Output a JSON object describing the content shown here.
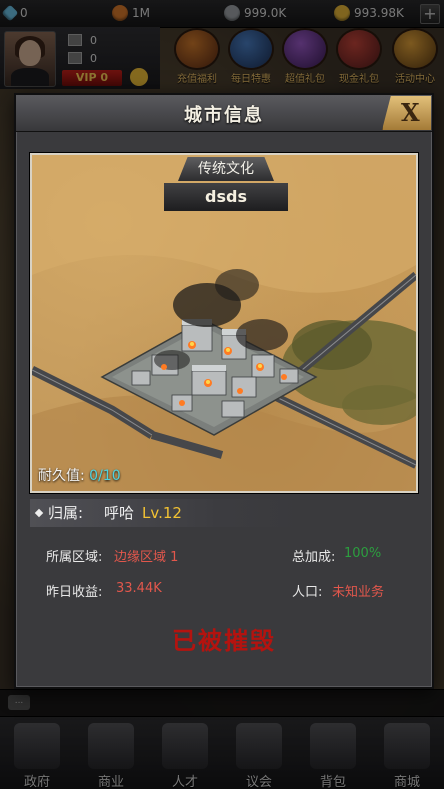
{
  "topbar": {
    "resources": [
      {
        "icon": "diamond-icon",
        "value": "0",
        "color": "#6cc3e8"
      },
      {
        "icon": "food-icon",
        "value": "1M",
        "color": "#d97a2c"
      },
      {
        "icon": "silver-icon",
        "value": "999.0K",
        "color": "#9ea3a8"
      },
      {
        "icon": "gold-coin-icon",
        "value": "993.98K",
        "color": "#e9b93a"
      }
    ],
    "add_label": "+"
  },
  "player": {
    "stat1": "0",
    "stat2": "0",
    "vip": "VIP 0"
  },
  "events": [
    {
      "label": "充值福利"
    },
    {
      "label": "每日特惠"
    },
    {
      "label": "超值礼包"
    },
    {
      "label": "现金礼包"
    },
    {
      "label": "活动中心"
    }
  ],
  "nav": [
    {
      "label": "政府"
    },
    {
      "label": "商业"
    },
    {
      "label": "人才"
    },
    {
      "label": "议会"
    },
    {
      "label": "背包"
    },
    {
      "label": "商城"
    }
  ],
  "chat_icon": "...",
  "dialog": {
    "title": "城市信息",
    "close": "X",
    "culture_tag": "传统文化",
    "city_name": "dsds",
    "durability_label": "耐久值:",
    "durability_value": "0/10",
    "owner_label": "归属:",
    "owner_name": "呼哈",
    "owner_level": "Lv.12",
    "region_label": "所属区域:",
    "region_value": "边缘区域 1",
    "bonus_label": "总加成:",
    "bonus_value": "100%",
    "income_label": "昨日收益:",
    "income_value": "33.44K",
    "population_label": "人口:",
    "population_value": "未知业务",
    "status": "已被摧毁"
  }
}
